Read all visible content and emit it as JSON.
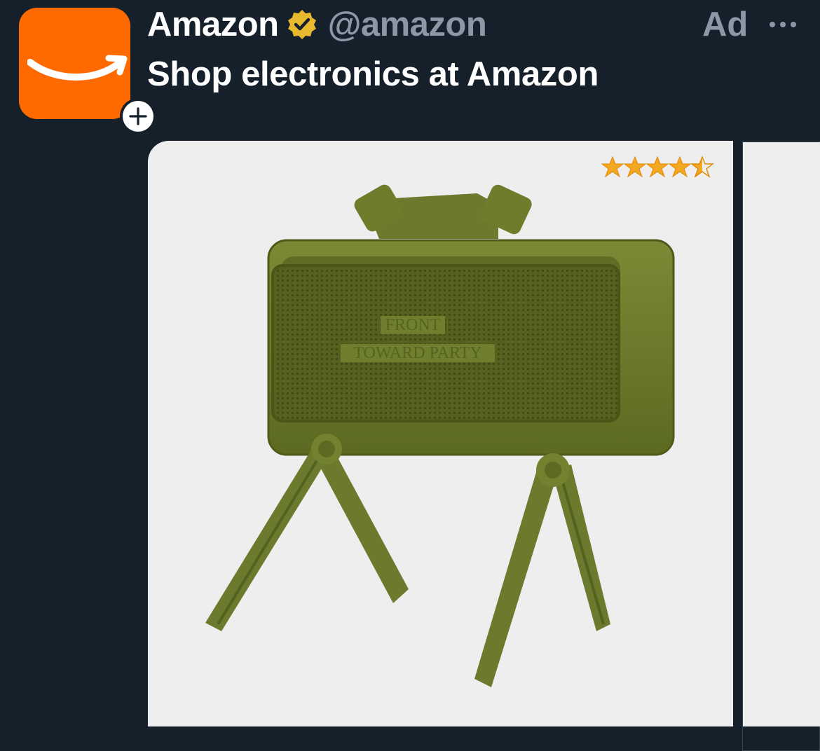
{
  "ad": {
    "author_name": "Amazon",
    "author_handle": "@amazon",
    "ad_label": "Ad",
    "headline": "Shop electronics at Amazon",
    "verified_icon": "verified-badge-icon",
    "more_icon": "more-options-icon",
    "follow_icon": "plus-icon"
  },
  "carousel": {
    "cards": [
      {
        "product_name": "",
        "product_text_front": "FRONT",
        "product_text_back": "TOWARD PARTY",
        "rating": 4.5,
        "rating_max": 5
      },
      {
        "product_name": ""
      }
    ]
  },
  "colors": {
    "background": "#15202b",
    "brand_orange": "#ff6a00",
    "verified_gold": "#e8b92f",
    "secondary_text": "#8b98a5",
    "star_color": "#f5a623",
    "product_green": "#6b7a2c"
  }
}
